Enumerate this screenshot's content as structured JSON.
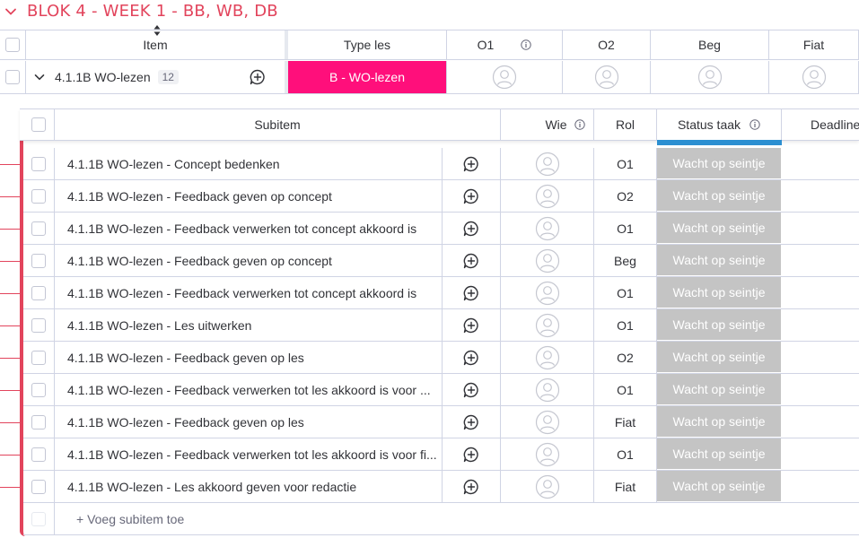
{
  "group": {
    "title": "BLOK 4 - WEEK 1 - BB, WB, DB",
    "accent": "#e2445c"
  },
  "main_table": {
    "headers": {
      "item": "Item",
      "type_les": "Type les",
      "o1": "O1",
      "o2": "O2",
      "beg": "Beg",
      "fiat": "Fiat"
    },
    "item": {
      "name": "4.1.1B WO-lezen",
      "subitem_count": "12",
      "type_les": "B - WO-lezen",
      "type_color": "#ff0f7b"
    }
  },
  "subitems": {
    "headers": {
      "subitem": "Subitem",
      "wie": "Wie",
      "rol": "Rol",
      "status": "Status taak",
      "deadline": "Deadline"
    },
    "rows": [
      {
        "name": "4.1.1B WO-lezen - Concept bedenken",
        "rol": "O1",
        "status": "Wacht op seintje"
      },
      {
        "name": "4.1.1B WO-lezen - Feedback geven op concept",
        "rol": "O2",
        "status": "Wacht op seintje"
      },
      {
        "name": "4.1.1B WO-lezen - Feedback verwerken tot concept akkoord is",
        "rol": "O1",
        "status": "Wacht op seintje"
      },
      {
        "name": "4.1.1B WO-lezen - Feedback geven op concept",
        "rol": "Beg",
        "status": "Wacht op seintje"
      },
      {
        "name": "4.1.1B WO-lezen - Feedback verwerken tot concept akkoord is",
        "rol": "O1",
        "status": "Wacht op seintje"
      },
      {
        "name": "4.1.1B WO-lezen - Les uitwerken",
        "rol": "O1",
        "status": "Wacht op seintje"
      },
      {
        "name": "4.1.1B WO-lezen - Feedback geven op les",
        "rol": "O2",
        "status": "Wacht op seintje"
      },
      {
        "name": "4.1.1B WO-lezen - Feedback verwerken tot les akkoord is voor ...",
        "rol": "O1",
        "status": "Wacht op seintje"
      },
      {
        "name": "4.1.1B WO-lezen - Feedback geven op les",
        "rol": "Fiat",
        "status": "Wacht op seintje"
      },
      {
        "name": "4.1.1B WO-lezen - Feedback verwerken tot les akkoord is voor fi...",
        "rol": "O1",
        "status": "Wacht op seintje"
      },
      {
        "name": "4.1.1B WO-lezen - Les akkoord geven voor redactie",
        "rol": "Fiat",
        "status": "Wacht op seintje"
      }
    ],
    "add_label": "+ Voeg subitem toe",
    "status_color": "#c4c4c4"
  }
}
